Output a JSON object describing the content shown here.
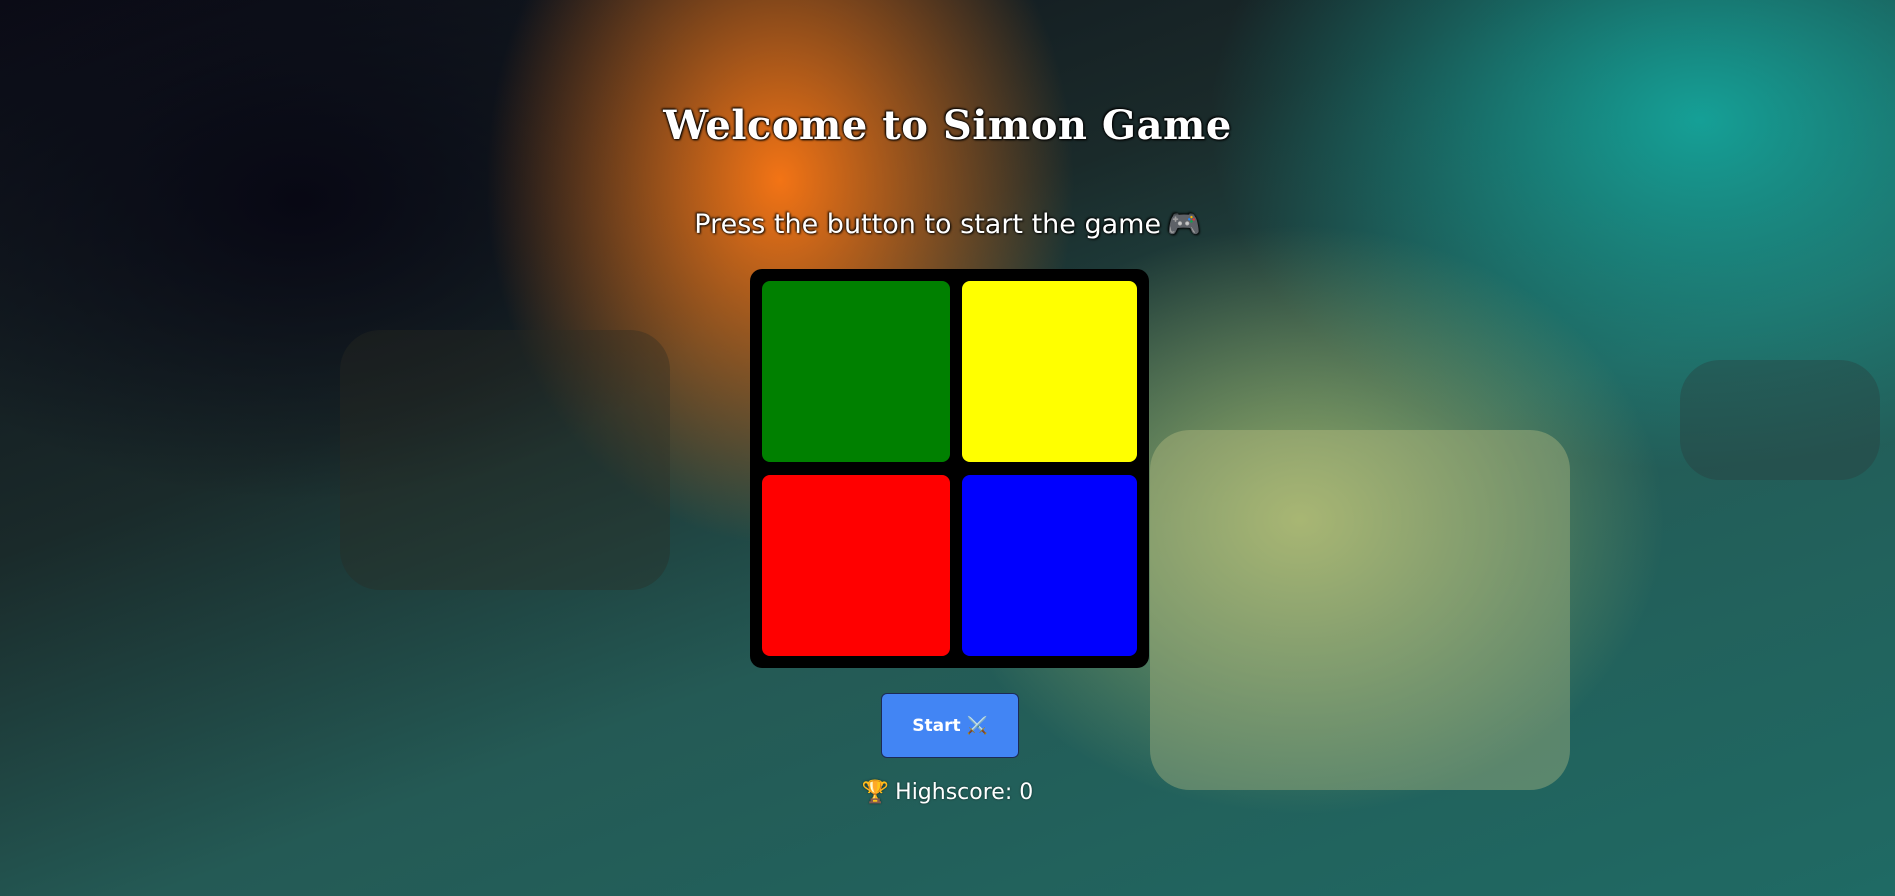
{
  "title": "Welcome to Simon Game",
  "subtitle": "Press the button to start the game",
  "subtitle_icon": "game-controller-icon",
  "board": {
    "pads": [
      {
        "name": "green",
        "color": "#008000"
      },
      {
        "name": "yellow",
        "color": "#ffff00"
      },
      {
        "name": "red",
        "color": "#ff0000"
      },
      {
        "name": "blue",
        "color": "#0000ff"
      }
    ]
  },
  "start_button": {
    "label": "Start",
    "icon": "crossed-swords-icon",
    "color": "#4285f4"
  },
  "highscore": {
    "icon": "trophy-icon",
    "text": "Highscore: 0"
  }
}
